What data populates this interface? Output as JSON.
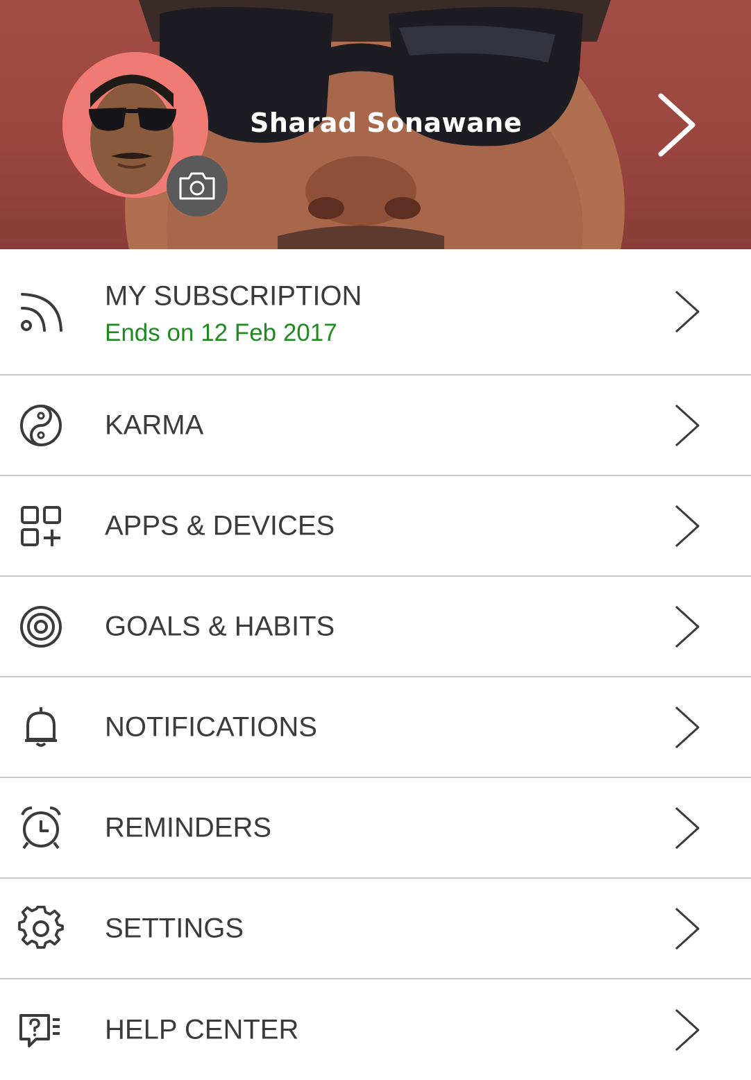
{
  "profile": {
    "name": "Sharad Sonawane"
  },
  "menu": {
    "items": [
      {
        "label": "MY SUBSCRIPTION",
        "sublabel": "Ends on 12 Feb 2017",
        "icon": "rss-icon"
      },
      {
        "label": "KARMA",
        "icon": "yin-yang-icon"
      },
      {
        "label": "APPS & DEVICES",
        "icon": "apps-add-icon"
      },
      {
        "label": "GOALS & HABITS",
        "icon": "target-icon"
      },
      {
        "label": "NOTIFICATIONS",
        "icon": "bell-icon"
      },
      {
        "label": "REMINDERS",
        "icon": "alarm-clock-icon"
      },
      {
        "label": "SETTINGS",
        "icon": "gear-icon"
      },
      {
        "label": "HELP CENTER",
        "icon": "help-icon"
      }
    ]
  },
  "colors": {
    "header_bg": "#9c4640",
    "subscription_text": "#1f8a1f",
    "divider": "#c9c9c9",
    "icon": "#3b3b3b"
  }
}
